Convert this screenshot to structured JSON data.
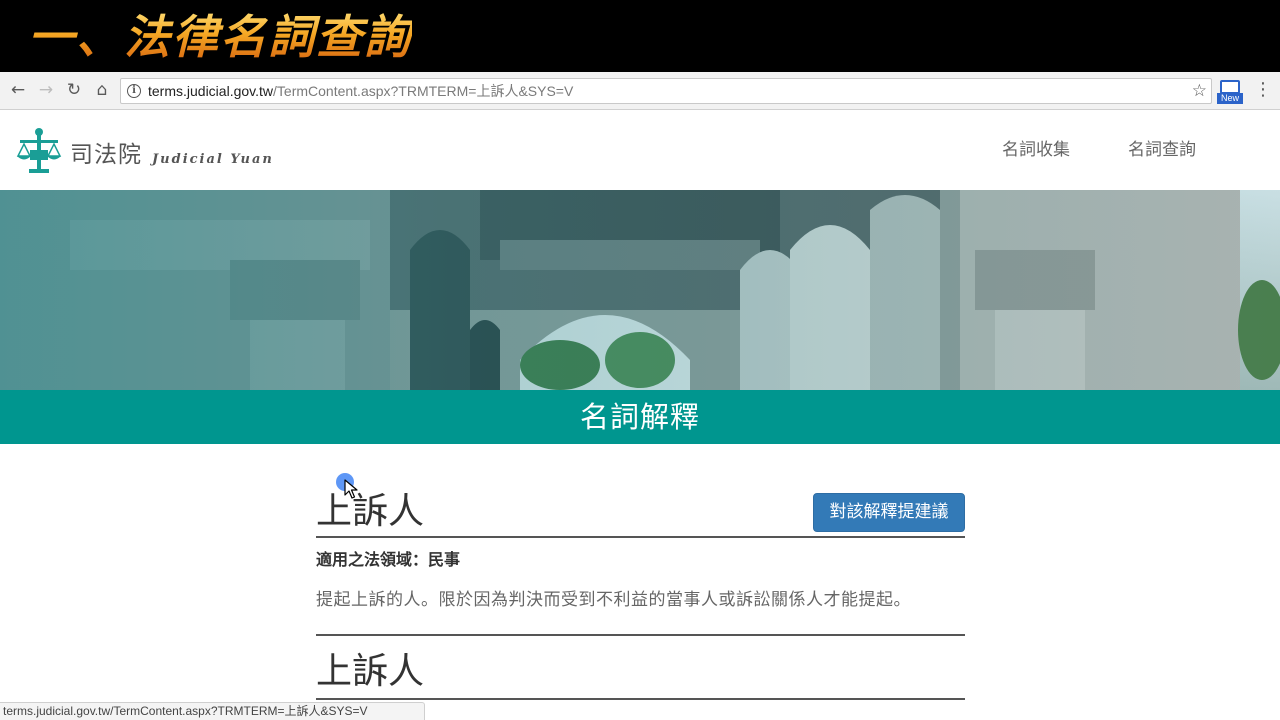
{
  "caption": {
    "text": "一、法律名詞查詢"
  },
  "browser": {
    "url_domain": "terms.judicial.gov.tw",
    "url_path": "/TermContent.aspx?TRMTERM=上訴人&SYS=V",
    "extension_badge": "New",
    "status_url": "terms.judicial.gov.tw/TermContent.aspx?TRMTERM=上訴人&SYS=V"
  },
  "site": {
    "logo_text": "司法院",
    "logo_sub": "Judicial Yuan",
    "nav": [
      {
        "label": "名詞收集"
      },
      {
        "label": "名詞查詢"
      }
    ],
    "section_title": "名詞解釋"
  },
  "term": {
    "title": "上訴人",
    "suggest_button": "對該解釋提建議",
    "field": "適用之法領域：民事",
    "definition": "提起上訴的人。限於因為判決而受到不利益的當事人或訴訟關係人才能提起。",
    "next_title": "上訴人"
  },
  "colors": {
    "teal": "#00968f",
    "button_blue": "#337ab7",
    "caption_gold": "#f5a623"
  },
  "icons": [
    "back-icon",
    "forward-icon",
    "reload-icon",
    "home-icon",
    "info-icon",
    "star-icon",
    "extension-icon",
    "menu-icon",
    "scales-logo-icon",
    "cursor-icon"
  ]
}
